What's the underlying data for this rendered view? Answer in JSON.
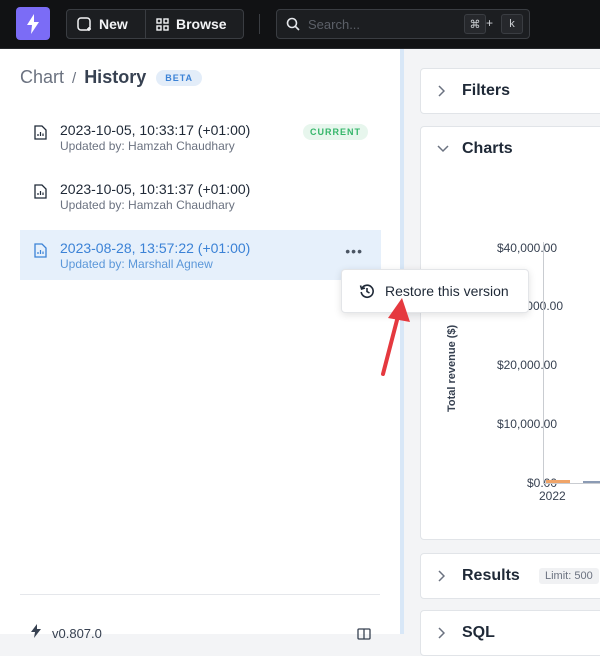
{
  "topbar": {
    "new_label": "New",
    "browse_label": "Browse",
    "search_placeholder": "Search...",
    "shortcut_cmd": "⌘",
    "shortcut_plus": "+",
    "shortcut_key": "k"
  },
  "breadcrumb": {
    "root": "Chart",
    "separator": "/",
    "current": "History",
    "badge": "BETA"
  },
  "versions": [
    {
      "date": "2023-10-05, 10:33:17 (+01:00)",
      "updated_by": "Updated by: Hamzah Chaudhary",
      "badge": "CURRENT",
      "selected": false
    },
    {
      "date": "2023-10-05, 10:31:37 (+01:00)",
      "updated_by": "Updated by: Hamzah Chaudhary",
      "badge": "",
      "selected": false
    },
    {
      "date": "2023-08-28, 13:57:22 (+01:00)",
      "updated_by": "Updated by: Marshall Agnew",
      "badge": "",
      "selected": true
    }
  ],
  "more_menu": {
    "dots": "•••",
    "restore_label": "Restore this version"
  },
  "footer": {
    "version": "v0.807.0"
  },
  "panels": {
    "filters_title": "Filters",
    "charts_title": "Charts",
    "results_title": "Results",
    "results_limit": "Limit: 500",
    "sql_title": "SQL"
  },
  "chart_data": {
    "type": "bar",
    "ylabel": "Total revenue ($)",
    "yticks": [
      "$40,000.00",
      "$30,000.00",
      "$20,000.00",
      "$10,000.00",
      "$0.00"
    ],
    "xticks": [
      "2022"
    ],
    "colors": {
      "series_orange": "#f0a468",
      "series_slate": "#8b9bb4"
    }
  },
  "colors": {
    "accent": "#3b82d6",
    "logo_bg": "#7b6cf6",
    "current_green": "#35b66a",
    "arrow_red": "#e5393f"
  }
}
